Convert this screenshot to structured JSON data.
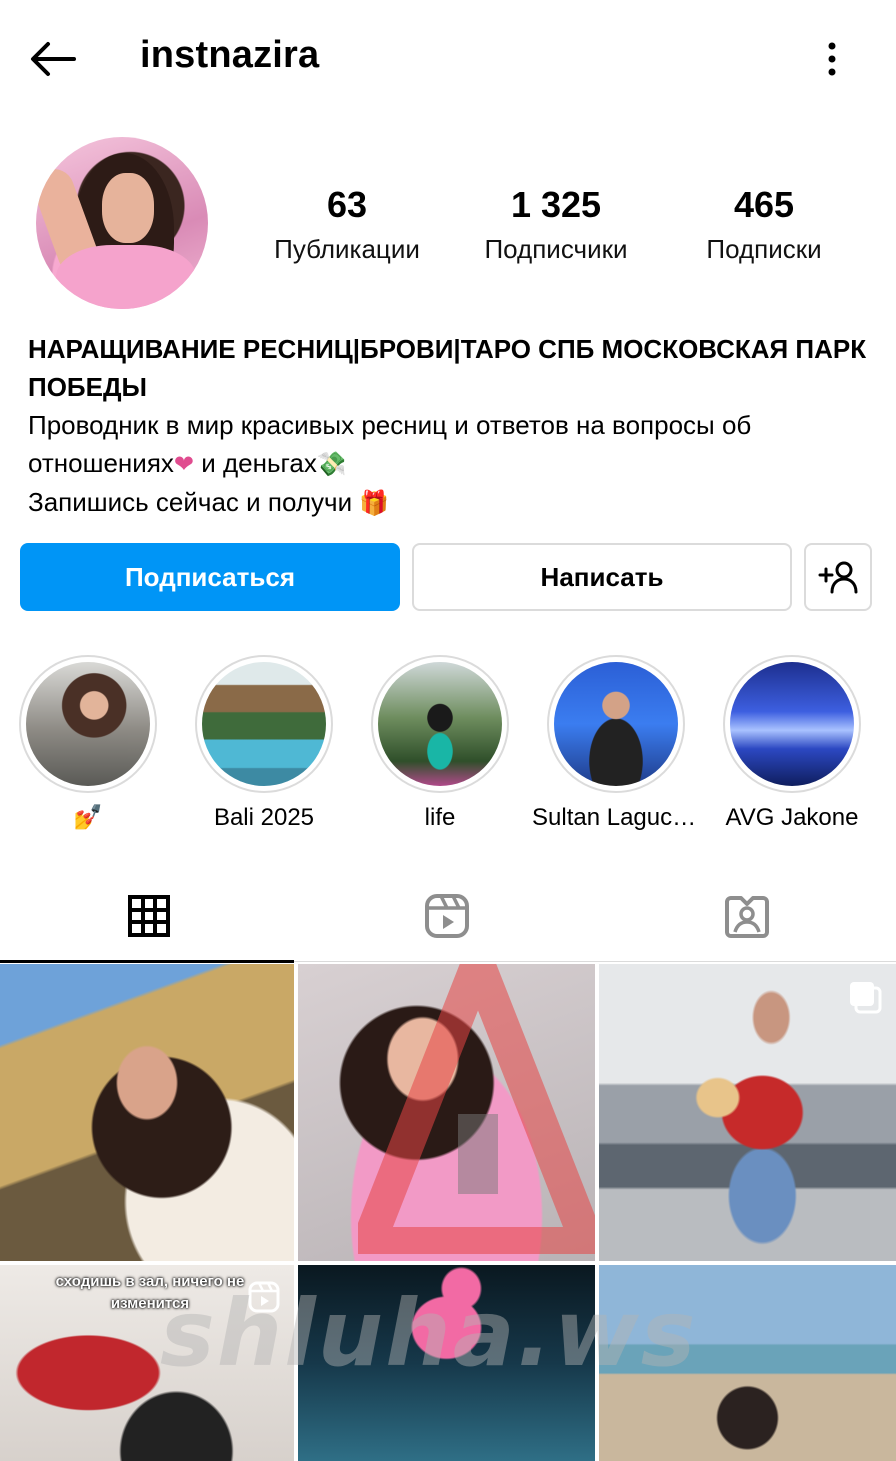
{
  "header": {
    "username": "instnazira"
  },
  "profile": {
    "stats": {
      "posts": {
        "value": "63",
        "label": "Публикации"
      },
      "followers": {
        "value": "1 325",
        "label": "Подписчики"
      },
      "following": {
        "value": "465",
        "label": "Подписки"
      }
    },
    "bio": {
      "name": "НАРАЩИВАНИЕ РЕСНИЦ|БРОВИ|ТАРО СПБ МОСКОВСКАЯ ПАРК ПОБЕДЫ",
      "line1": "Проводник в мир красивых ресниц и ответов  на вопросы об отношениях",
      "line1_tail": " и деньгах",
      "line2": "Запишись сейчас и получи "
    }
  },
  "actions": {
    "follow_label": "Подписаться",
    "message_label": "Написать"
  },
  "highlights": [
    {
      "label": "💅",
      "icon": "nail-polish-emoji"
    },
    {
      "label": "Bali 2025"
    },
    {
      "label": "life"
    },
    {
      "label": "Sultan Laguch..."
    },
    {
      "label": "AVG Jakone"
    }
  ],
  "posts": {
    "reel_caption": "сходишь в зал, ничего не изменится"
  },
  "watermark": "shluha.ws",
  "colors": {
    "accent": "#0095f6",
    "border": "#dbdbdb"
  },
  "icons": [
    "back-arrow-icon",
    "more-vertical-icon",
    "add-person-icon",
    "grid-icon",
    "reels-icon",
    "tagged-icon",
    "multi-photo-icon",
    "reel-icon"
  ]
}
